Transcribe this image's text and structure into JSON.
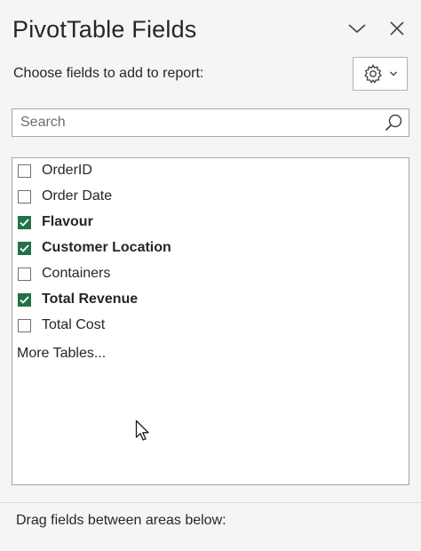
{
  "pane": {
    "title": "PivotTable Fields",
    "collapse_icon": "chevron-down-icon",
    "close_icon": "close-icon"
  },
  "toolbar": {
    "choose_label": "Choose fields to add to report:",
    "tools_icon": "gear-icon",
    "tools_dropdown_icon": "caret-down-icon"
  },
  "search": {
    "placeholder": "Search",
    "value": "",
    "icon": "search-icon"
  },
  "fields": [
    {
      "label": "OrderID",
      "checked": false
    },
    {
      "label": "Order Date",
      "checked": false
    },
    {
      "label": "Flavour",
      "checked": true
    },
    {
      "label": "Customer Location",
      "checked": true
    },
    {
      "label": "Containers",
      "checked": false
    },
    {
      "label": "Total Revenue",
      "checked": true
    },
    {
      "label": "Total Cost",
      "checked": false
    }
  ],
  "more_tables": "More Tables...",
  "areas": {
    "drag_label": "Drag fields between areas below:"
  },
  "colors": {
    "checkbox_checked": "#217346",
    "pane_background": "#f5f5f5"
  }
}
